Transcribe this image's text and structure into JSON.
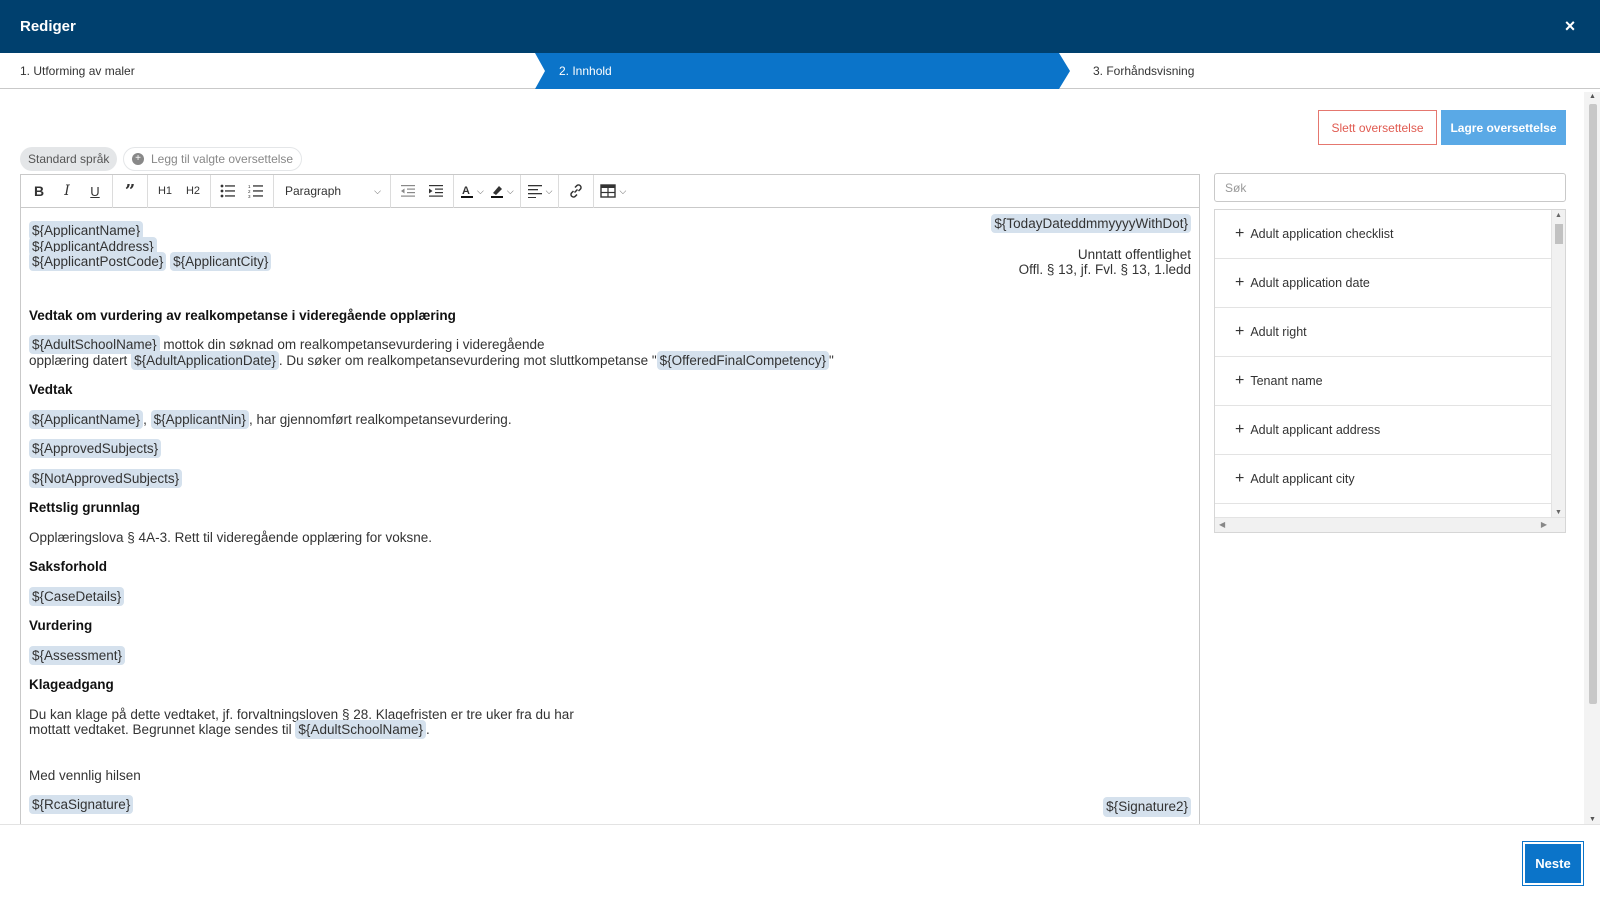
{
  "header": {
    "title": "Rediger",
    "close": "×"
  },
  "steps": [
    "1. Utforming av maler",
    "2. Innhold",
    "3. Forhåndsvisning"
  ],
  "actions": {
    "delete": "Slett oversettelse",
    "save": "Lagre oversettelse"
  },
  "languages": {
    "standard": "Standard språk",
    "add": "Legg til valgte oversettelse"
  },
  "toolbar": {
    "h1": "H1",
    "h2": "H2",
    "block_format": "Paragraph"
  },
  "document": {
    "applicant_name": "${ApplicantName}",
    "applicant_address": "${ApplicantAddress}",
    "applicant_postcode": "${ApplicantPostCode}",
    "applicant_city": "${ApplicantCity}",
    "today": "${TodayDateddmmyyyyWithDot}",
    "exempt": "Unntatt offentlighet",
    "offl": "Offl. § 13, jf. Fvl. § 13, 1.ledd",
    "main_title": "Vedtak om vurdering av realkompetanse i videregående opplæring",
    "school_name": "${AdultSchoolName}",
    "p1_a": " mottok din søknad om realkompetansevurdering i videregående",
    "p1_b": "opplæring datert ",
    "application_date": "${AdultApplicationDate}",
    "p1_c": ". Du søker om realkompetansevurdering mot sluttkompetanse \"",
    "offered_competency": "${OfferedFinalCompetency}",
    "p1_d": "\"",
    "h_vedtak": "Vedtak",
    "applicant_name2": "${ApplicantName}",
    "comma": ",",
    "applicant_nin": "${ApplicantNin}",
    "p2": ",  har gjennomført realkompetansevurdering.",
    "approved": "${ApprovedSubjects}",
    "not_approved": "${NotApprovedSubjects}",
    "h_rettslig": "Rettslig grunnlag",
    "p_rettslig": "Opplæringslova § 4A-3. Rett til videregående opplæring for voksne.",
    "h_saksforhold": "Saksforhold",
    "case_details": "${CaseDetails}",
    "h_vurdering": "Vurdering",
    "assessment": "${Assessment}",
    "h_klage": "Klageadgang",
    "p_klage_a": "Du kan klage på dette vedtaket, jf. forvaltningsloven § 28. Klagefristen er tre uker fra du har",
    "p_klage_b": "mottatt vedtaket. Begrunnet klage sendes til ",
    "school_name2": "${AdultSchoolName}",
    "period": ".",
    "greeting": "Med vennlig hilsen",
    "rca_signature": "${RcaSignature}",
    "signature2": "${Signature2}"
  },
  "search": {
    "placeholder": "Søk"
  },
  "variables": [
    "Adult application checklist",
    "Adult application date",
    "Adult right",
    "Tenant name",
    "Adult applicant address",
    "Adult applicant city"
  ],
  "footer": {
    "next": "Neste"
  },
  "colors": {
    "header": "#00406e",
    "active_step": "#0b74c9",
    "save": "#5aa9e6",
    "delete": "#e05a50",
    "variable_bg": "#d5e1ed"
  }
}
